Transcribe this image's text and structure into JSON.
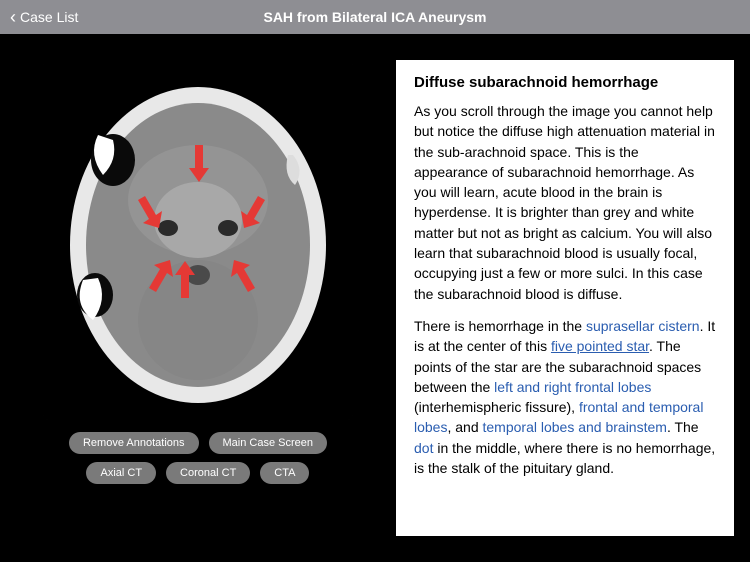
{
  "navbar": {
    "back_label": "Case List",
    "title": "SAH from Bilateral ICA Aneurysm"
  },
  "buttons": {
    "remove_annotations": "Remove Annotations",
    "main_case_screen": "Main Case Screen",
    "axial_ct": "Axial CT",
    "coronal_ct": "Coronal CT",
    "cta": "CTA"
  },
  "article": {
    "title": "Diffuse subarachnoid hemorrhage",
    "p1": "As you scroll through the image you cannot help but notice the diffuse high attenuation material in the sub-arachnoid space. This is the appearance of subarachnoid hemorrhage. As you will learn, acute blood in the brain is hyperdense. It is brighter than grey and white matter but not as bright as calcium. You will also learn that subarachnoid blood is usually focal, occupying just a few or more sulci. In this case the subarachnoid blood is diffuse.",
    "p2_a": "There is hemorrhage in the ",
    "p2_link1": "suprasellar cistern",
    "p2_b": ". It is at the center of this ",
    "p2_link2": "five pointed star",
    "p2_c": ". The points of the star are the subarachnoid spaces between the ",
    "p2_link3": "left and right frontal lobes",
    "p2_d": " (interhemispheric fissure), ",
    "p2_link4": "frontal and temporal lobes",
    "p2_e": ", and ",
    "p2_link5": "temporal lobes and brainstem",
    "p2_f": ". The ",
    "p2_link6": "dot",
    "p2_g": " in the middle, where there is no hemorrhage, is the stalk of the pituitary gland."
  },
  "icons": {
    "back_chevron": "chevron-left-icon"
  }
}
